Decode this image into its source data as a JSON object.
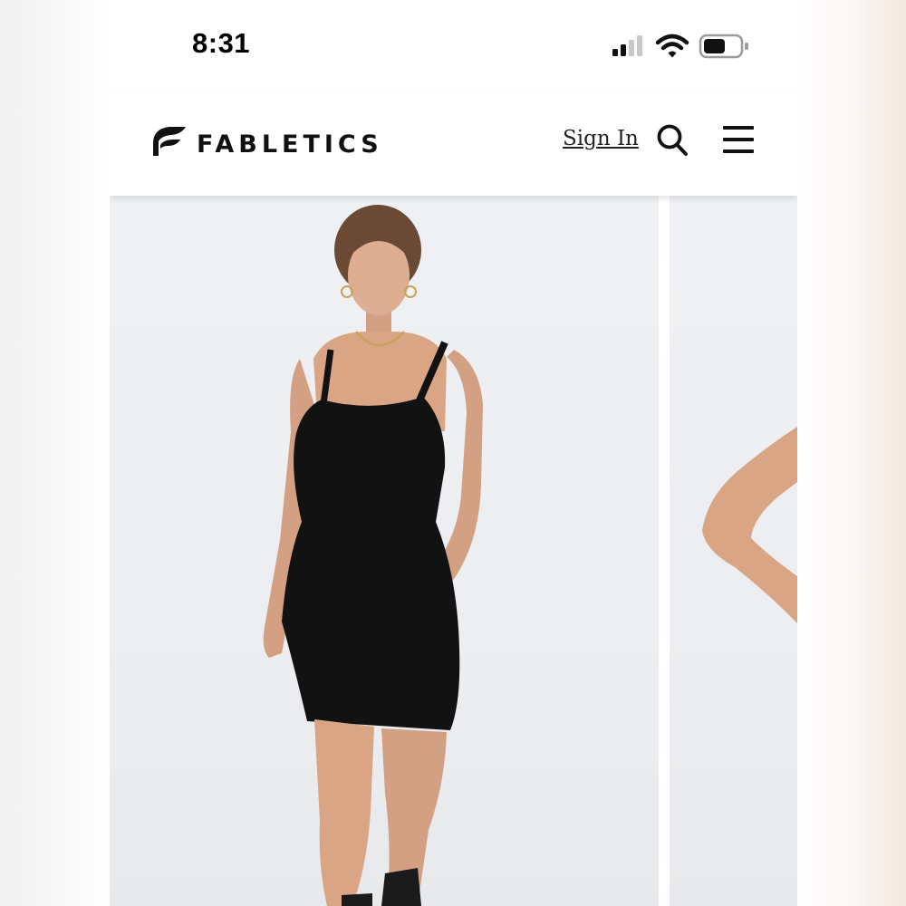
{
  "status_bar": {
    "time": "8:31",
    "icons": [
      "cellular-signal-icon",
      "wifi-icon",
      "battery-icon"
    ]
  },
  "header": {
    "brand": "FABLETICS",
    "sign_in_label": "Sign In",
    "icons": [
      "fabletics-logo-mark",
      "search-icon",
      "hamburger-menu-icon"
    ]
  },
  "product_gallery": {
    "images": [
      {
        "subject": "model wearing black fuzzy mini slip dress"
      },
      {
        "subject": "partial view of model arm"
      }
    ]
  },
  "colors": {
    "text": "#111111",
    "background": "#ffffff",
    "image_background": "#eceef1",
    "dress": "#121212",
    "skin": "#d9a585"
  }
}
